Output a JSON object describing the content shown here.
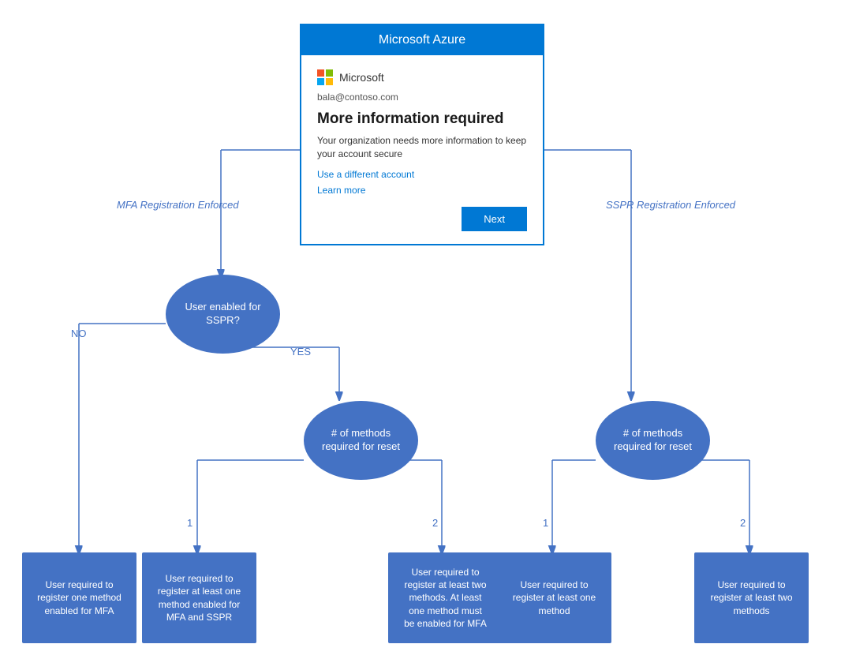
{
  "card": {
    "header": "Microsoft Azure",
    "logo_text": "Microsoft",
    "email": "bala@contoso.com",
    "title": "More information required",
    "description": "Your organization needs more information to keep your account secure",
    "link1": "Use a different account",
    "link2": "Learn more",
    "next_button": "Next"
  },
  "labels": {
    "mfa_enforced": "MFA Registration Enforced",
    "sspr_enforced": "SSPR Registration Enforced",
    "sspr_question": "User enabled for\nSSPR?",
    "no": "NO",
    "yes": "YES",
    "methods_left": "# of methods\nrequired for reset",
    "methods_right": "# of methods\nrequired for reset",
    "one_left": "1",
    "two_left": "2",
    "one_right": "1",
    "two_right": "2"
  },
  "boxes": {
    "box1": "User required to\nregister one method\nenabled for MFA",
    "box2": "User required to\nregister at least one\nmethod enabled for\nMFA and SSPR",
    "box3": "User required to\nregister at least two\nmethods. At least\none method must\nbe enabled for MFA",
    "box4": "User required to\nregister at least one\nmethod",
    "box5": "User required to\nregister at least two\nmethods"
  }
}
